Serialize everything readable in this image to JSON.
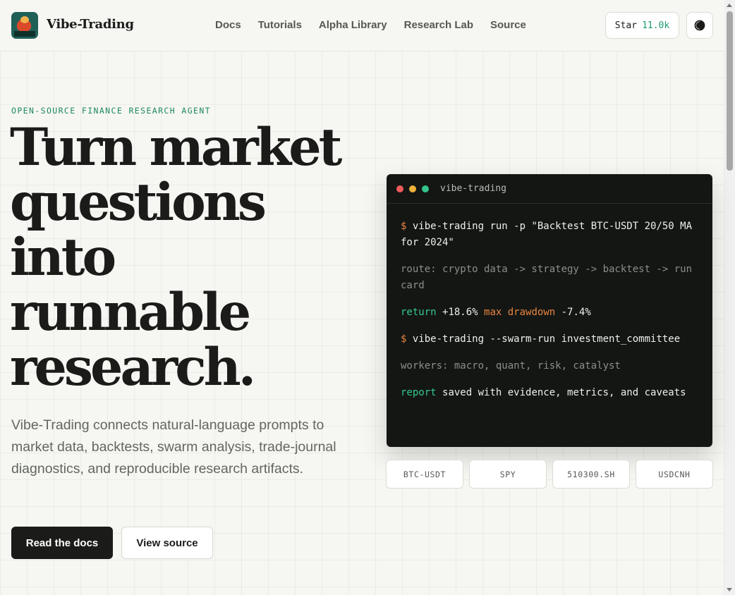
{
  "header": {
    "brand": "Vibe-Trading",
    "nav": [
      "Docs",
      "Tutorials",
      "Alpha Library",
      "Research Lab",
      "Source"
    ],
    "star_label": "Star",
    "star_count": "11.0k",
    "theme_icon": "contrast-icon"
  },
  "hero": {
    "eyebrow": "OPEN-SOURCE FINANCE RESEARCH AGENT",
    "title_lines": [
      "Turn market",
      "questions",
      "into",
      "runnable",
      "research."
    ],
    "description": "Vibe-Trading connects natural-language prompts to market data, backtests, swarm analysis, trade-journal diagnostics, and reproducible research artifacts.",
    "primary_button": "Read the docs",
    "secondary_button": "View source"
  },
  "terminal": {
    "title": "vibe-trading",
    "prompt": "$",
    "line1_cmd": "vibe-trading run -p \"Backtest BTC-USDT 20/50 MA for 2024\"",
    "line2": "route: crypto data -> strategy -> backtest -> run card",
    "line3_label1": "return",
    "line3_value1": "+18.6%",
    "line3_label2": "max drawdown",
    "line3_value2": "-7.4%",
    "line4_cmd": "vibe-trading --swarm-run investment_committee",
    "line5": "workers: macro, quant, risk, catalyst",
    "line6_label": "report",
    "line6_text": "saved with evidence, metrics, and caveats"
  },
  "tickers": [
    "BTC-USDT",
    "SPY",
    "510300.SH",
    "USDCNH"
  ],
  "colors": {
    "accent_green": "#1e9a6c",
    "terminal_bg": "#141614",
    "prompt_orange": "#e8853f",
    "page_bg": "#f6f6f2"
  }
}
